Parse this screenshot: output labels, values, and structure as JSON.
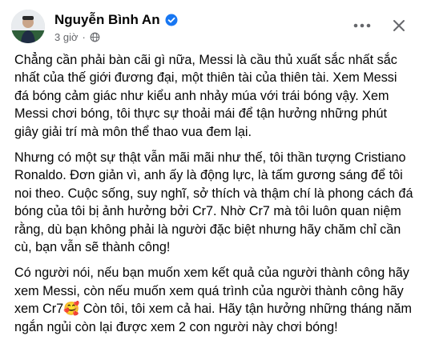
{
  "post": {
    "author": "Nguyễn Bình An",
    "time": "3 giờ",
    "separator": "·",
    "icons": {
      "verified": "verified-badge-icon",
      "audience": "globe-icon",
      "more": "more-horizontal-icon",
      "close": "close-icon"
    },
    "colors": {
      "verified": "#1877f2",
      "secondary_text": "#65676b",
      "text": "#050505"
    },
    "paragraphs": [
      "Chẳng cần phải bàn cãi gì nữa, Messi là cầu thủ xuất sắc nhất sắc nhất của thế giới đương đại, một thiên tài của thiên tài. Xem Messi đá bóng cảm giác như kiểu anh nhảy múa với trái bóng vậy. Xem Messi chơi bóng, tôi thực sự thoải mái để tận hưởng những phút giây giải trí mà môn thể thao vua đem lại.",
      "Nhưng có một sự thật vẫn mãi mãi như thế, tôi thần tượng Cristiano Ronaldo. Đơn giản vì, anh ấy là động lực, là tấm gương sáng để tôi noi theo. Cuộc sống, suy nghĩ, sở thích và thậm chí là phong cách đá bóng của tôi bị ảnh hưởng bởi Cr7. Nhờ Cr7 mà tôi luôn quan niệm rằng, dù bạn không phải là người đặc biệt nhưng hãy chăm chỉ cần cù, bạn vẫn sẽ thành công!",
      "Có người nói, nếu bạn muốn xem kết quả của người thành công hãy xem Messi, còn nếu muốn xem quá trình của người thành công hãy xem Cr7🥰 Còn tôi, tôi xem cả hai. Hãy tận hưởng những tháng năm ngắn ngủi còn lại được xem 2 con người này chơi bóng!"
    ]
  }
}
